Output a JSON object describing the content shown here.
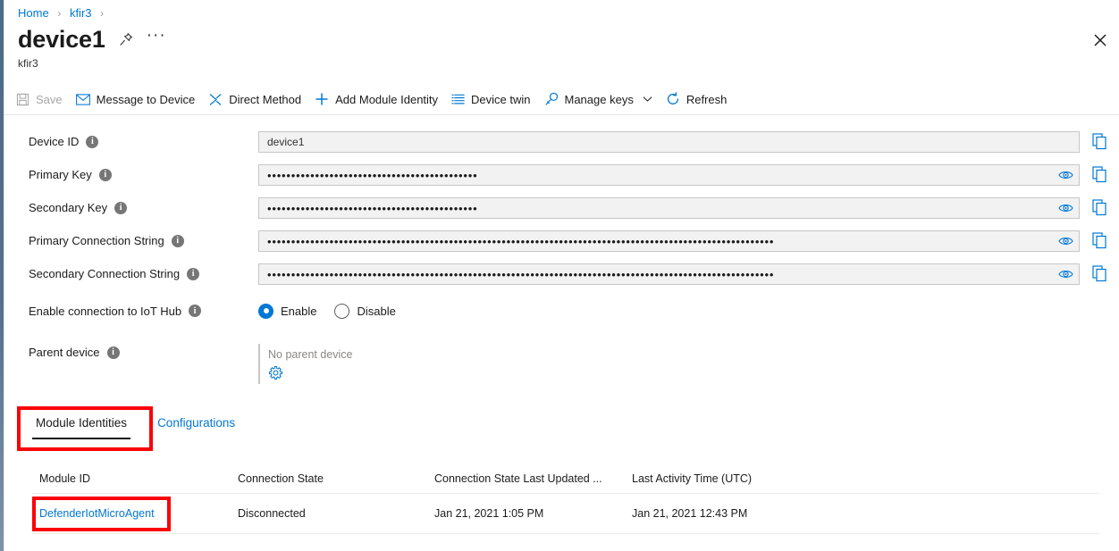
{
  "breadcrumb": {
    "items": [
      {
        "label": "Home"
      },
      {
        "label": "kfir3"
      }
    ],
    "separator": "›"
  },
  "header": {
    "title": "device1",
    "subtitle": "kfir3",
    "pin_icon": "pin-icon",
    "more_label": "···",
    "close_icon": "close-icon"
  },
  "toolbar": {
    "items": [
      {
        "label": "Save",
        "icon": "save-icon",
        "disabled": true
      },
      {
        "label": "Message to Device",
        "icon": "envelope-icon",
        "disabled": false
      },
      {
        "label": "Direct Method",
        "icon": "direct-method-icon",
        "disabled": false
      },
      {
        "label": "Add Module Identity",
        "icon": "plus-icon",
        "disabled": false
      },
      {
        "label": "Device twin",
        "icon": "list-icon",
        "disabled": false
      },
      {
        "label": "Manage keys",
        "icon": "key-icon",
        "disabled": false,
        "chevron": true
      },
      {
        "label": "Refresh",
        "icon": "refresh-icon",
        "disabled": false
      }
    ]
  },
  "form": {
    "device_id": {
      "label": "Device ID",
      "value": "device1",
      "copy_icon": "copy-icon"
    },
    "primary_key": {
      "label": "Primary Key",
      "value": "••••••••••••••••••••••••••••••••••••••••••••",
      "reveal_icon": "eye-icon",
      "copy_icon": "copy-icon"
    },
    "secondary_key": {
      "label": "Secondary Key",
      "value": "••••••••••••••••••••••••••••••••••••••••••••",
      "reveal_icon": "eye-icon",
      "copy_icon": "copy-icon"
    },
    "primary_connection_string": {
      "label": "Primary Connection String",
      "value": "••••••••••••••••••••••••••••••••••••••••••••••••••••••••••••••••••••••••••••••••••••••••••••••••••••••••••",
      "reveal_icon": "eye-icon",
      "copy_icon": "copy-icon"
    },
    "secondary_connection_string": {
      "label": "Secondary Connection String",
      "value": "••••••••••••••••••••••••••••••••••••••••••••••••••••••••••••••••••••••••••••••••••••••••••••••••••••••••••",
      "reveal_icon": "eye-icon",
      "copy_icon": "copy-icon"
    },
    "enable_connection": {
      "label": "Enable connection to IoT Hub",
      "options": [
        {
          "label": "Enable",
          "selected": true
        },
        {
          "label": "Disable",
          "selected": false
        }
      ]
    },
    "parent_device": {
      "label": "Parent device",
      "value": "No parent device",
      "settings_icon": "gear-icon"
    }
  },
  "tabs": [
    {
      "label": "Module Identities",
      "active": true
    },
    {
      "label": "Configurations",
      "active": false
    }
  ],
  "table": {
    "columns": [
      "Module ID",
      "Connection State",
      "Connection State Last Updated ...",
      "Last Activity Time (UTC)"
    ],
    "rows": [
      {
        "module_id": "DefenderIotMicroAgent",
        "connection_state": "Disconnected",
        "connection_state_last_updated": "Jan 21, 2021 1:05 PM",
        "last_activity_time": "Jan 21, 2021 12:43 PM"
      }
    ]
  },
  "colors": {
    "accent": "#0078d4",
    "annotation": "#fb0007",
    "rail": "#4a6b8a"
  }
}
